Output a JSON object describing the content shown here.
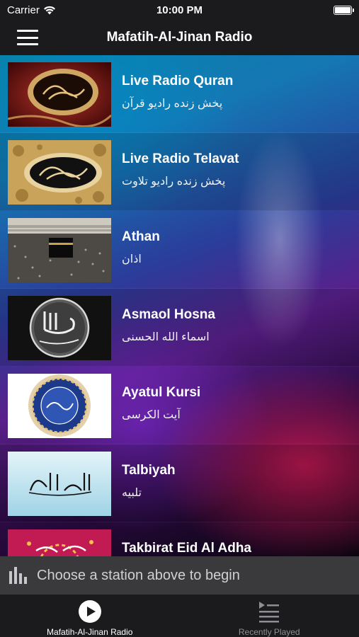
{
  "status_bar": {
    "carrier": "Carrier",
    "time": "10:00 PM",
    "battery_level": 1.0
  },
  "nav": {
    "title": "Mafatih-Al-Jinan Radio",
    "menu_icon": "hamburger-menu-icon"
  },
  "stations": [
    {
      "name": "Live Radio Quran",
      "subtitle": "پخش زنده رادیو قرآن",
      "thumbnail": "quran-calligraphy-thumbnail"
    },
    {
      "name": "Live Radio Telavat",
      "subtitle": "پخش زنده رادیو تلاوت",
      "thumbnail": "quran-gold-thumbnail"
    },
    {
      "name": "Athan",
      "subtitle": "اذان",
      "thumbnail": "kaaba-thumbnail"
    },
    {
      "name": "Asmaol Hosna",
      "subtitle": "اسماء الله الحسنی",
      "thumbnail": "allah-calligraphy-thumbnail"
    },
    {
      "name": "Ayatul Kursi",
      "subtitle": "آیت الکرسی",
      "thumbnail": "ayatul-kursi-thumbnail"
    },
    {
      "name": "Talbiyah",
      "subtitle": "تلبیه",
      "thumbnail": "talbiyah-thumbnail"
    },
    {
      "name": "Takbirat Eid Al Adha",
      "subtitle": "",
      "thumbnail": "eid-thumbnail"
    }
  ],
  "now_playing": {
    "text": "Choose a station above to begin",
    "icon": "equalizer-bars-icon"
  },
  "tabs": [
    {
      "label": "Mafatih-Al-Jinan Radio",
      "icon": "play-circle-icon",
      "active": true
    },
    {
      "label": "Recently Played",
      "icon": "playlist-icon",
      "active": false
    }
  ],
  "colors": {
    "bar_background": "#1b1b1d",
    "now_playing_background": "#3a3a3c",
    "inactive_tab": "#8e8e93"
  }
}
